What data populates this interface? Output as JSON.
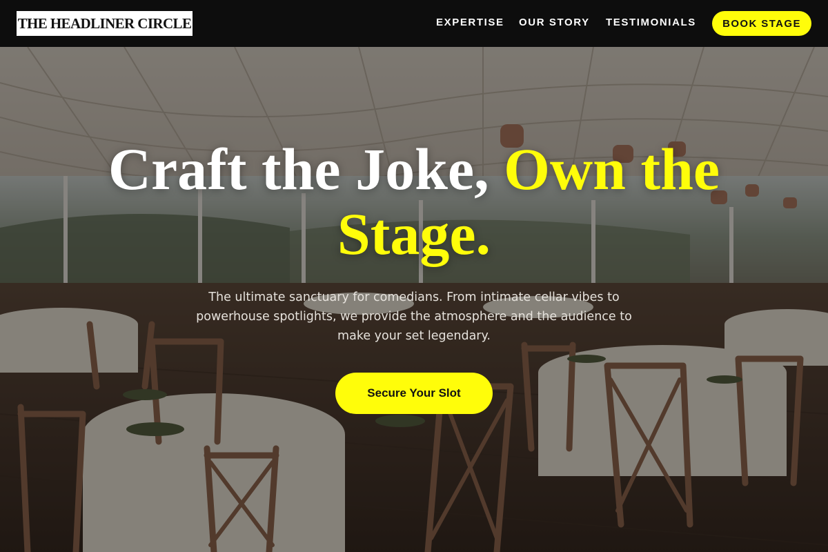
{
  "header": {
    "logo_text": "THE HEADLINER CIRCLE",
    "nav": {
      "expertise": "EXPERTISE",
      "our_story": "OUR STORY",
      "testimonials": "TESTIMONIALS"
    },
    "cta_label": "BOOK STAGE"
  },
  "hero": {
    "title_white": "Craft the Joke, ",
    "title_accent": "Own the Stage.",
    "subtitle": "The ultimate sanctuary for comedians. From intimate cellar vibes to powerhouse spotlights, we provide the atmosphere and the audience to make your set legendary.",
    "cta_label": "Secure Your Slot"
  },
  "theme": {
    "accent": "#fffd0a",
    "header_bg": "#0d0d0d",
    "text_light": "#ffffff"
  },
  "background": {
    "description_icon": "banquet-hall-photo"
  }
}
